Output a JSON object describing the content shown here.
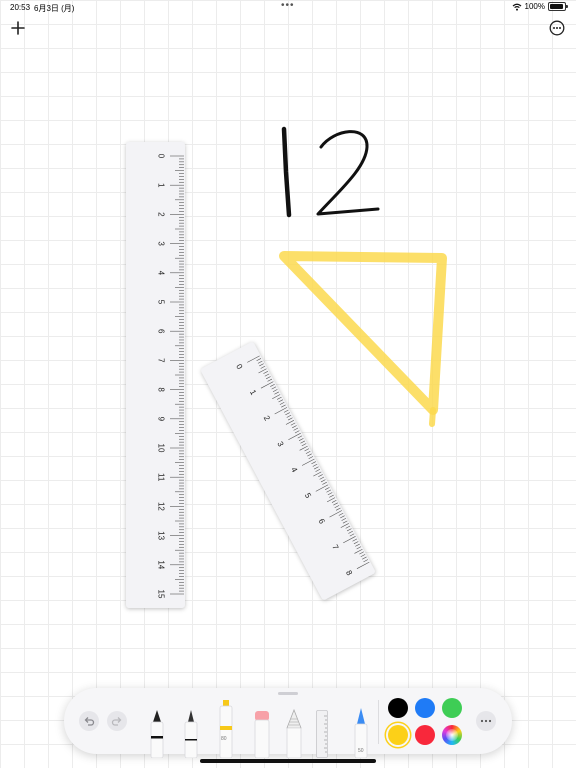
{
  "status_bar": {
    "time": "20:53",
    "date": "6月3日 (月)",
    "battery": "100%"
  },
  "canvas": {
    "handwriting": "12",
    "ink_colors": {
      "black": "#111111",
      "highlighter": "#fcd94f"
    }
  },
  "rulers": {
    "vertical_labels": [
      "0",
      "1",
      "2",
      "3",
      "4",
      "5",
      "6",
      "7",
      "8",
      "9",
      "10",
      "11",
      "12",
      "13",
      "14",
      "15"
    ],
    "diagonal_labels": [
      "0",
      "1",
      "2",
      "3",
      "4",
      "5",
      "6",
      "7",
      "8"
    ]
  },
  "toolbar": {
    "tools": [
      {
        "name": "pen",
        "icon": "pen-icon"
      },
      {
        "name": "monoline",
        "icon": "monoline-icon"
      },
      {
        "name": "highlighter",
        "icon": "highlighter-icon",
        "label": "80"
      },
      {
        "name": "eraser",
        "icon": "eraser-icon"
      },
      {
        "name": "pencil",
        "icon": "pencil-icon"
      },
      {
        "name": "ruler",
        "icon": "ruler-icon"
      },
      {
        "name": "fountain",
        "icon": "fountain-pen-icon",
        "label": "50"
      }
    ],
    "colors": [
      "#000000",
      "#1f7bf6",
      "#3ecd55",
      "#fcd018",
      "#f8283b"
    ],
    "selected_color": "#fcd018"
  }
}
